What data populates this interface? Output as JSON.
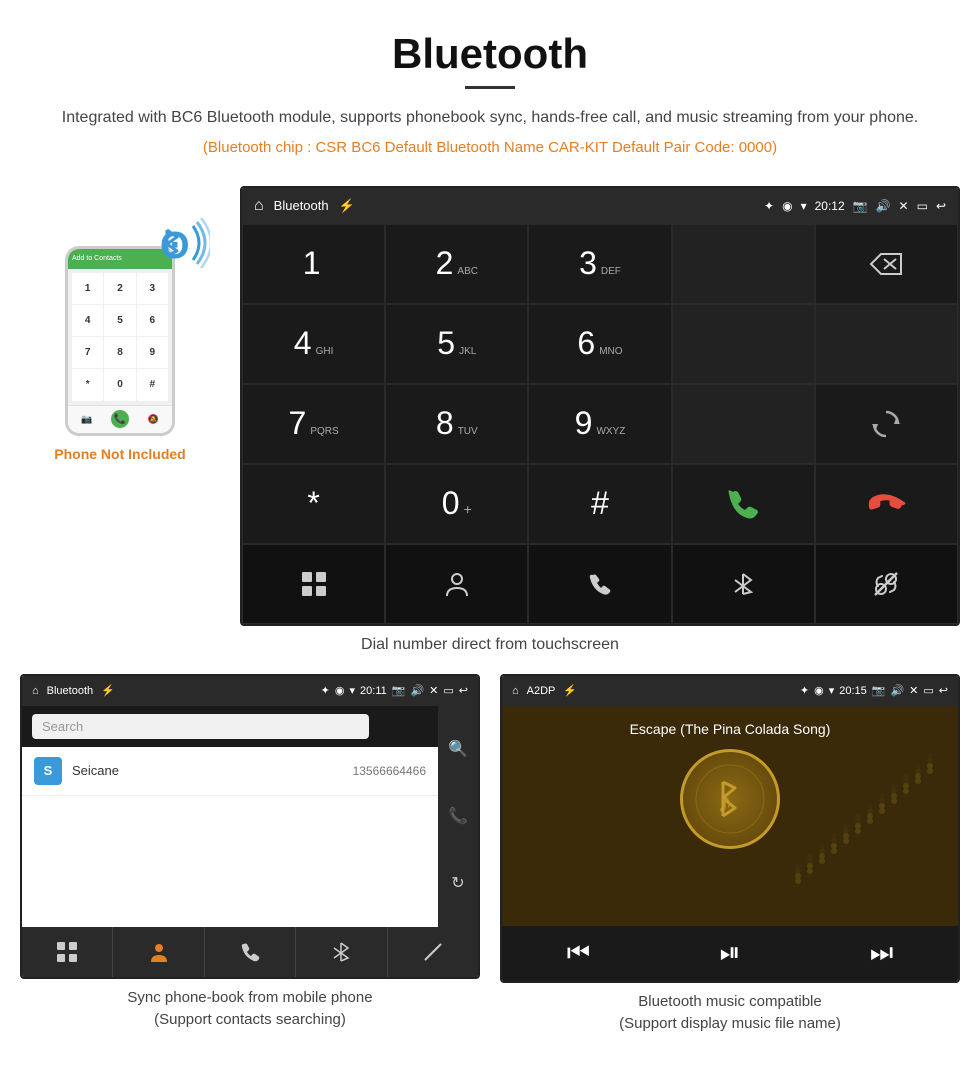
{
  "header": {
    "title": "Bluetooth",
    "description": "Integrated with BC6 Bluetooth module, supports phonebook sync, hands-free call, and music streaming from your phone.",
    "specs": "(Bluetooth chip : CSR BC6    Default Bluetooth Name CAR-KIT    Default Pair Code: 0000)"
  },
  "phone_side": {
    "not_included": "Phone Not Included",
    "bluetooth_signal": "📶"
  },
  "dialpad_screen": {
    "status_bar": {
      "title": "Bluetooth",
      "time": "20:12"
    },
    "keys": [
      {
        "main": "1",
        "sub": ""
      },
      {
        "main": "2",
        "sub": "ABC"
      },
      {
        "main": "3",
        "sub": "DEF"
      },
      {
        "main": "4",
        "sub": "GHI"
      },
      {
        "main": "5",
        "sub": "JKL"
      },
      {
        "main": "6",
        "sub": "MNO"
      },
      {
        "main": "7",
        "sub": "PQRS"
      },
      {
        "main": "8",
        "sub": "TUV"
      },
      {
        "main": "9",
        "sub": "WXYZ"
      },
      {
        "main": "*",
        "sub": ""
      },
      {
        "main": "0",
        "sub": "+"
      },
      {
        "main": "#",
        "sub": ""
      }
    ],
    "caption": "Dial number direct from touchscreen"
  },
  "phonebook_screen": {
    "status_bar": {
      "title": "Bluetooth",
      "time": "20:11"
    },
    "search_placeholder": "Search",
    "contacts": [
      {
        "initial": "S",
        "name": "Seicane",
        "phone": "13566664466"
      }
    ],
    "caption_line1": "Sync phone-book from mobile phone",
    "caption_line2": "(Support contacts searching)"
  },
  "music_screen": {
    "status_bar": {
      "title": "A2DP",
      "time": "20:15"
    },
    "song_title": "Escape (The Pina Colada Song)",
    "caption_line1": "Bluetooth music compatible",
    "caption_line2": "(Support display music file name)"
  },
  "icons": {
    "home": "⌂",
    "usb": "⚡",
    "bluetooth": "✦",
    "grid": "⊞",
    "person": "👤",
    "phone": "📞",
    "bt_symbol": "ʙ",
    "link": "🔗",
    "back": "↩",
    "search": "🔍",
    "refresh": "↻",
    "prev": "⏮",
    "play": "⏯",
    "next": "⏭",
    "skip_back": "⏪",
    "skip_fwd": "⏩",
    "camera": "📷",
    "volume": "🔊",
    "close_x": "✕",
    "rect": "▭",
    "wifi": "▾",
    "location": "◉"
  }
}
